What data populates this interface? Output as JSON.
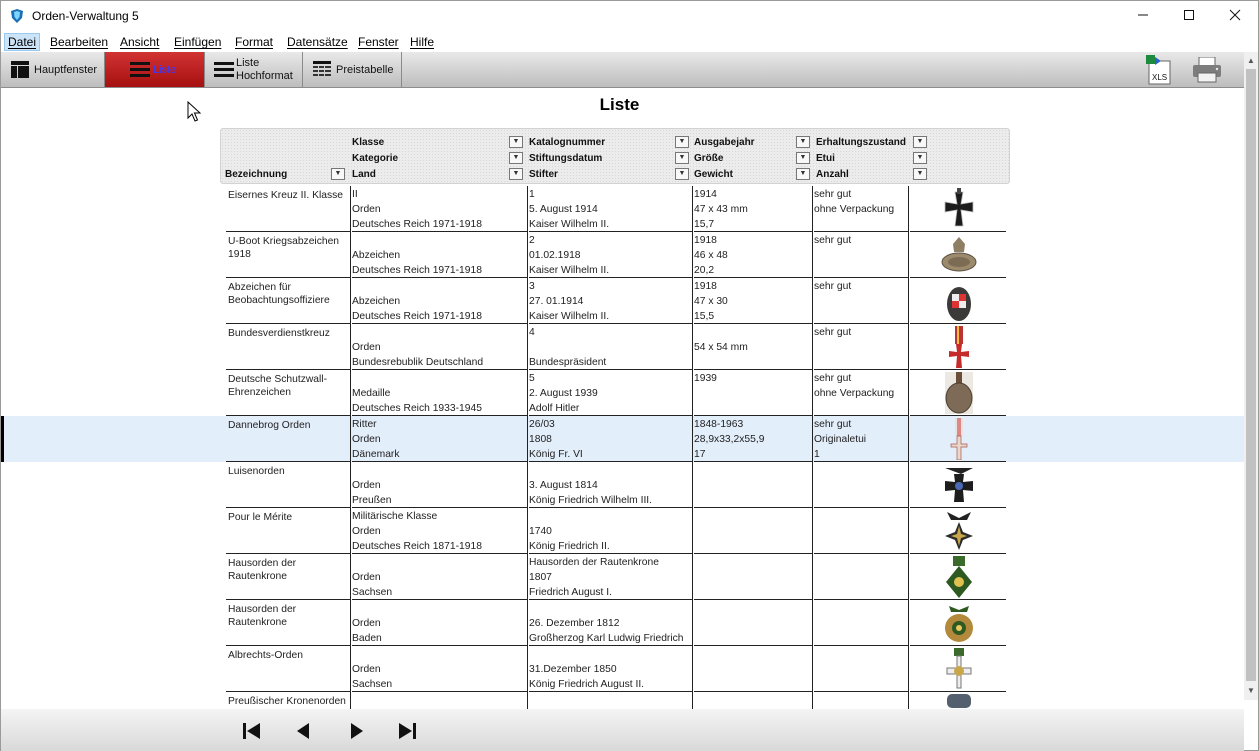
{
  "window": {
    "title": "Orden-Verwaltung 5"
  },
  "menu": [
    "Datei",
    "Bearbeiten",
    "Ansicht",
    "Einfügen",
    "Format",
    "Datensätze",
    "Fenster",
    "Hilfe"
  ],
  "toolbar": {
    "hauptfenster": "Hauptfenster",
    "liste": "Liste",
    "liste_hoch_1": "Liste",
    "liste_hoch_2": "Hochformat",
    "preistabelle": "Preistabelle",
    "xls": "XLS"
  },
  "page": {
    "title": "Liste"
  },
  "headers": {
    "bezeichnung": "Bezeichnung",
    "klasse": "Klasse",
    "kategorie": "Kategorie",
    "land": "Land",
    "katalognummer": "Katalognummer",
    "stiftungsdatum": "Stiftungsdatum",
    "stifter": "Stifter",
    "ausgabejahr": "Ausgabejahr",
    "groesse": "Größe",
    "gewicht": "Gewicht",
    "erhaltungszustand": "Erhaltungszustand",
    "etui": "Etui",
    "anzahl": "Anzahl"
  },
  "rows": [
    {
      "name": "Eisernes Kreuz II. Klasse",
      "c2": [
        "II",
        "Orden",
        "Deutsches Reich 1971-1918"
      ],
      "c3": [
        "1",
        "5. August 1914",
        "Kaiser Wilhelm II."
      ],
      "c4": [
        "1914",
        "47 x 43 mm",
        "15,7"
      ],
      "c5": [
        "sehr gut",
        "ohne Verpackung",
        ""
      ],
      "thumb": "iron-cross"
    },
    {
      "name": "U-Boot Kriegsabzeichen 1918",
      "c2": [
        "",
        "Abzeichen",
        "Deutsches Reich 1971-1918"
      ],
      "c3": [
        "2",
        "01.02.1918",
        "Kaiser Wilhelm II."
      ],
      "c4": [
        "1918",
        "46 x 48",
        "20,2"
      ],
      "c5": [
        "sehr gut",
        "",
        ""
      ],
      "thumb": "uboat"
    },
    {
      "name": "Abzeichen für Beobachtungsoffiziere",
      "c2": [
        "",
        "Abzeichen",
        "Deutsches Reich 1971-1918"
      ],
      "c3": [
        "3",
        "27. 01.1914",
        "Kaiser Wilhelm II."
      ],
      "c4": [
        "1918",
        "47 x 30",
        "15,5"
      ],
      "c5": [
        "sehr gut",
        "",
        ""
      ],
      "thumb": "observer"
    },
    {
      "name": "Bundesverdienstkreuz",
      "c2": [
        "",
        "Orden",
        "Bundesrebublik Deutschland"
      ],
      "c3": [
        "4",
        "",
        "Bundespräsident"
      ],
      "c4": [
        "",
        "54 x 54 mm",
        ""
      ],
      "c5": [
        "sehr gut",
        "",
        ""
      ],
      "thumb": "bvk"
    },
    {
      "name": "Deutsche Schutzwall-Ehrenzeichen",
      "c2": [
        "",
        "Medaille",
        "Deutsches Reich 1933-1945"
      ],
      "c3": [
        "5",
        "2. August 1939",
        "Adolf Hitler"
      ],
      "c4": [
        "1939",
        "",
        ""
      ],
      "c5": [
        "sehr gut",
        "ohne Verpackung",
        ""
      ],
      "thumb": "medal"
    },
    {
      "name": "Dannebrog Orden",
      "c2": [
        "Ritter",
        "Orden",
        "Dänemark"
      ],
      "c3": [
        "26/03",
        "1808",
        "König Fr. VI"
      ],
      "c4": [
        "1848-1963",
        "28,9x33,2x55,9",
        "17"
      ],
      "c5": [
        "sehr gut",
        "Originaletui",
        "1"
      ],
      "thumb": "dannebrog",
      "selected": true
    },
    {
      "name": "Luisenorden",
      "c2": [
        "",
        "Orden",
        "Preußen"
      ],
      "c3": [
        "",
        "3. August 1814",
        "König Friedrich Wilhelm III."
      ],
      "c4": [
        "",
        "",
        ""
      ],
      "c5": [
        "",
        "",
        ""
      ],
      "thumb": "luise"
    },
    {
      "name": "Pour le Mérite",
      "c2": [
        "Militärische Klasse",
        "Orden",
        "Deutsches Reich 1871-1918"
      ],
      "c3": [
        "",
        "1740",
        "König Friedrich II."
      ],
      "c4": [
        "",
        "",
        ""
      ],
      "c5": [
        "",
        "",
        ""
      ],
      "thumb": "plm"
    },
    {
      "name": "Hausorden der Rautenkrone",
      "c2": [
        "",
        "Orden",
        "Sachsen"
      ],
      "c3": [
        "Hausorden der Rautenkrone",
        "1807",
        "Friedrich August I."
      ],
      "c4": [
        "",
        "",
        ""
      ],
      "c5": [
        "",
        "",
        ""
      ],
      "thumb": "raute"
    },
    {
      "name": "Hausorden der Rautenkrone",
      "c2": [
        "",
        "Orden",
        "Baden"
      ],
      "c3": [
        "",
        "26. Dezember 1812",
        "Großherzog Karl Ludwig Friedrich"
      ],
      "c4": [
        "",
        "",
        ""
      ],
      "c5": [
        "",
        "",
        ""
      ],
      "thumb": "baden"
    },
    {
      "name": "Albrechts-Orden",
      "c2": [
        "",
        "Orden",
        "Sachsen"
      ],
      "c3": [
        "",
        "31.Dezember 1850",
        "König Friedrich August II."
      ],
      "c4": [
        "",
        "",
        ""
      ],
      "c5": [
        "",
        "",
        ""
      ],
      "thumb": "albrecht"
    },
    {
      "name": "Preußischer Kronenorden",
      "c2": [
        "",
        "",
        ""
      ],
      "c3": [
        "",
        "",
        ""
      ],
      "c4": [
        "",
        "",
        ""
      ],
      "c5": [
        "",
        "",
        ""
      ],
      "thumb": "krone"
    }
  ],
  "colors": {
    "selected_row": "#e3eefb",
    "active_tab": "#c01e1e",
    "active_tab_text": "#3a3aff"
  }
}
